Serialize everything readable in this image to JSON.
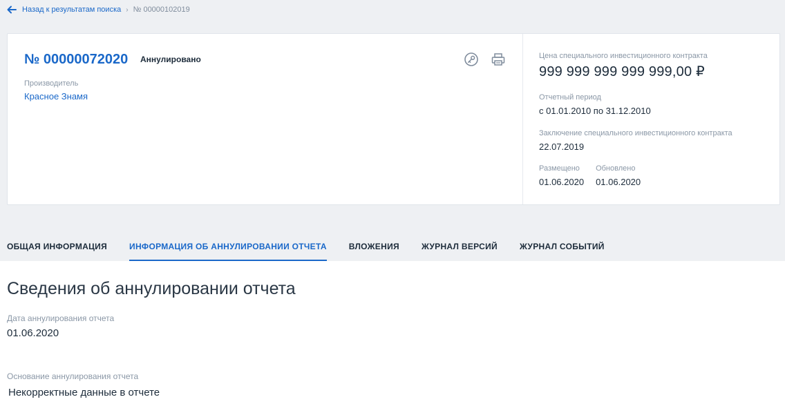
{
  "breadcrumb": {
    "back_label": "Назад к результатам поиска",
    "separator": "›",
    "current": "№ 00000102019"
  },
  "card": {
    "number": "№ 00000072020",
    "status": "Аннулировано",
    "producer_label": "Производитель",
    "producer_value": "Красное Знамя",
    "icons": [
      "signature-icon",
      "print-icon"
    ]
  },
  "side": {
    "price_label": "Цена специального инвестиционного контракта",
    "price_value": "999 999 999 999 999,00 ₽",
    "period_label": "Отчетный период",
    "period_value": "с 01.01.2010 по 31.12.2010",
    "conclusion_label": "Заключение специального инвестиционного контракта",
    "conclusion_value": "22.07.2019",
    "placed_label": "Размещено",
    "placed_value": "01.06.2020",
    "updated_label": "Обновлено",
    "updated_value": "01.06.2020"
  },
  "tabs": [
    {
      "label": "ОБЩАЯ ИНФОРМАЦИЯ"
    },
    {
      "label": "ИНФОРМАЦИЯ ОБ АННУЛИРОВАНИИ ОТЧЕТА",
      "active": true
    },
    {
      "label": "ВЛОЖЕНИЯ"
    },
    {
      "label": "ЖУРНАЛ ВЕРСИЙ"
    },
    {
      "label": "ЖУРНАЛ СОБЫТИЙ"
    }
  ],
  "section": {
    "title": "Сведения об аннулировании отчета",
    "date_label": "Дата аннулирования отчета",
    "date_value": "01.06.2020",
    "reason_label": "Основание аннулирования отчета",
    "reason_value": "Некорректные данные в отчете"
  },
  "colors": {
    "accent": "#1a68c9",
    "muted": "#8a97a6",
    "background": "#eef0f3"
  }
}
